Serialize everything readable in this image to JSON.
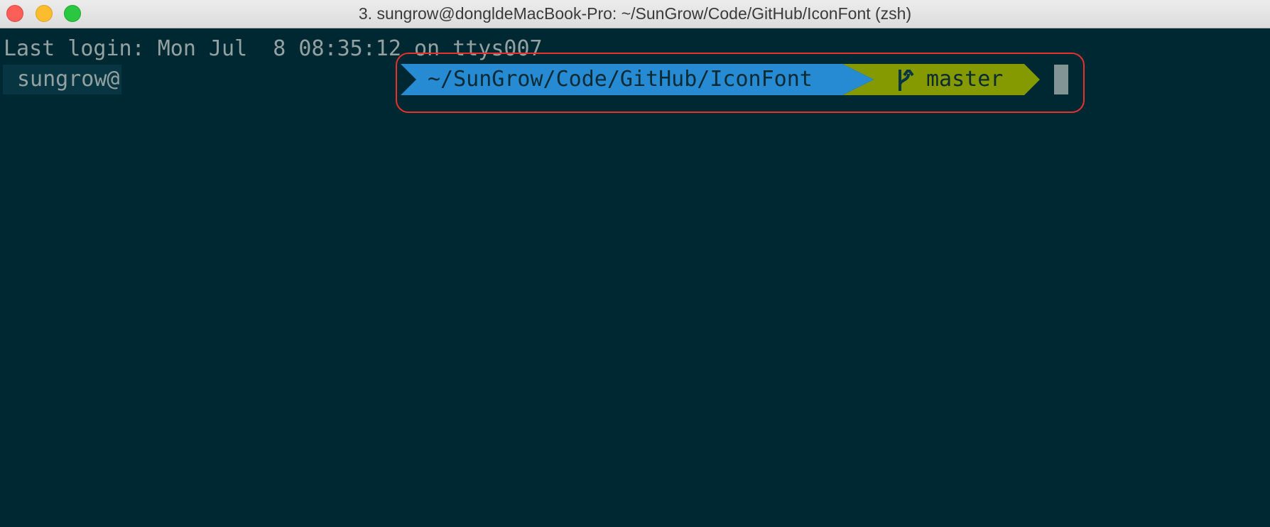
{
  "window": {
    "title": "3. sungrow@dongldeMacBook-Pro: ~/SunGrow/Code/GitHub/IconFont (zsh)"
  },
  "terminal": {
    "last_login_line": "Last login: Mon Jul  8 08:35:12 on ttys007",
    "user_segment": "sungrow@",
    "dir_segment": "~/SunGrow/Code/GitHub/IconFont",
    "git_icon": "git-branch-icon",
    "git_branch": "master"
  },
  "colors": {
    "background": "#002833",
    "dir_segment": "#268bd2",
    "git_segment": "#859900",
    "highlight_border": "#e5322d",
    "text": "#839496"
  }
}
